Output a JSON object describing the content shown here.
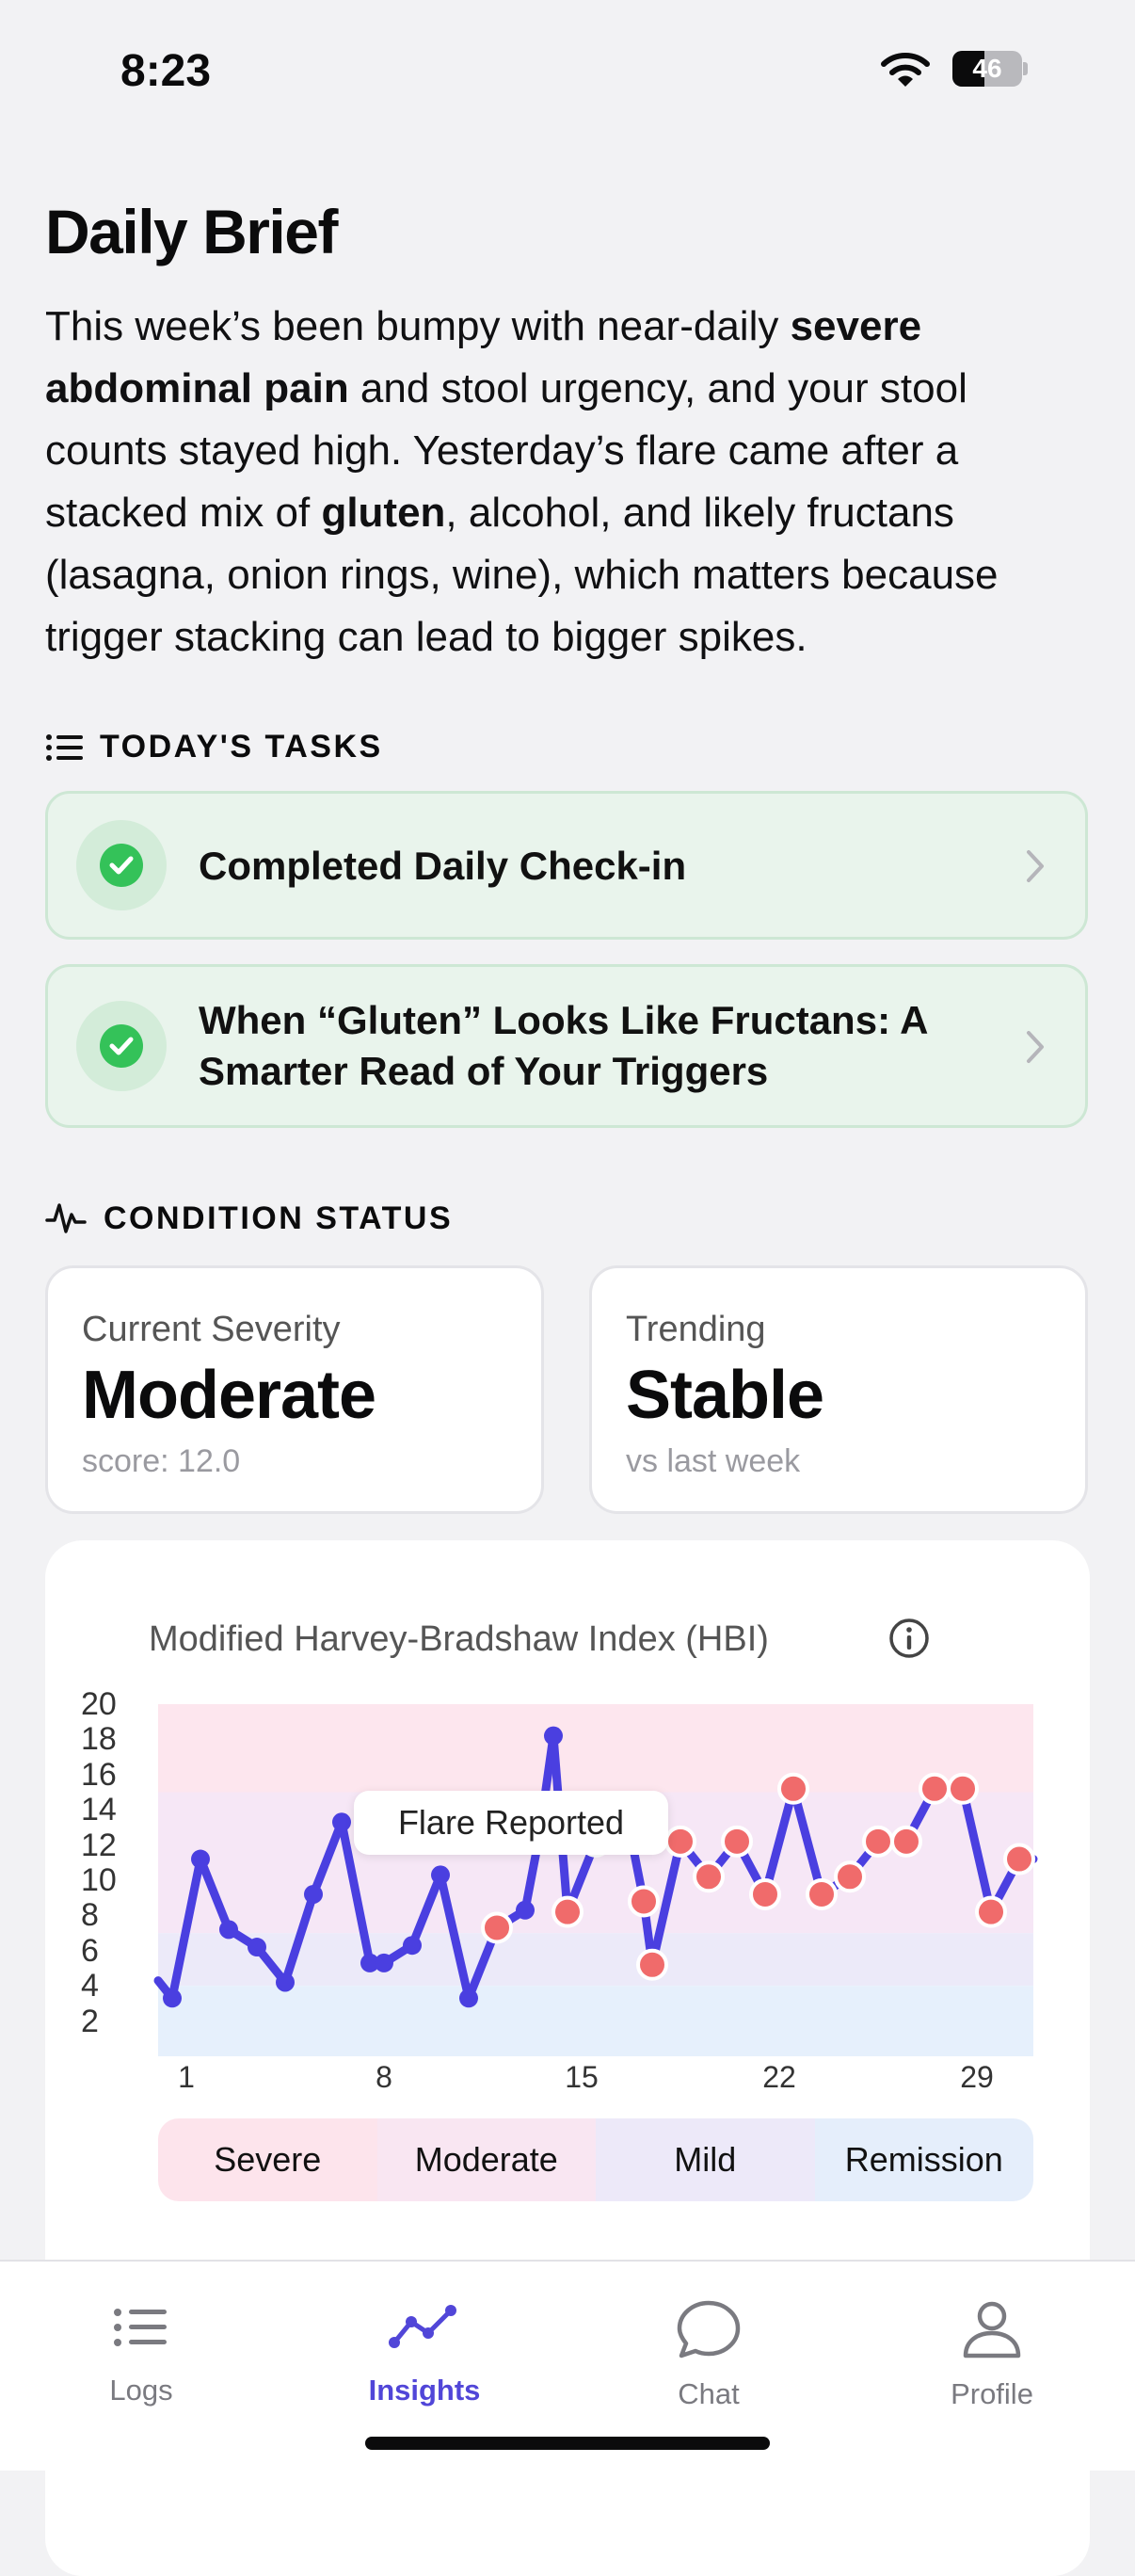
{
  "status_bar": {
    "time": "8:23",
    "battery": "46",
    "battery_level": 0.46
  },
  "brief": {
    "title": "Daily Brief",
    "segments": [
      {
        "t": "This week’s been bumpy with near-daily ",
        "b": false
      },
      {
        "t": "severe abdominal pain",
        "b": true
      },
      {
        "t": " and stool urgency, and your stool counts stayed high. Yesterday’s flare came after a stacked mix of ",
        "b": false
      },
      {
        "t": "gluten",
        "b": true
      },
      {
        "t": ", alcohol, and likely fructans (lasagna, onion rings, wine), which matters because trigger stacking can lead to bigger spikes.",
        "b": false
      }
    ]
  },
  "tasks": {
    "heading": "TODAY'S TASKS",
    "items": [
      {
        "label": "Completed Daily Check-in"
      },
      {
        "label": "When “Gluten” Looks Like Fructans: A Smarter Read of Your Triggers"
      }
    ]
  },
  "condition": {
    "heading": "CONDITION STATUS",
    "severity": {
      "label": "Current Severity",
      "value": "Moderate",
      "sub": "score: 12.0"
    },
    "trend": {
      "label": "Trending",
      "value": "Stable",
      "sub": "vs last week"
    }
  },
  "chart_data": {
    "type": "line",
    "title": "Modified Harvey-Bradshaw Index (HBI)",
    "annotation": "Flare Reported",
    "ylim": [
      0,
      20
    ],
    "y_ticks": [
      2,
      4,
      6,
      8,
      10,
      12,
      14,
      16,
      18,
      20
    ],
    "x_ticks": [
      1,
      8,
      15,
      22,
      29
    ],
    "xlim": [
      0,
      31
    ],
    "bands": [
      {
        "name": "Severe",
        "from": 15,
        "to": 20,
        "color": "#fde6ee"
      },
      {
        "name": "Moderate",
        "from": 7,
        "to": 15,
        "color": "#f6e7f6"
      },
      {
        "name": "Mild",
        "from": 4,
        "to": 7,
        "color": "#eceaf9"
      },
      {
        "name": "Remission",
        "from": 0,
        "to": 4,
        "color": "#e6f0fc"
      }
    ],
    "line_color": "#4a3fe0",
    "flare_color": "#f06b6b",
    "x": [
      0,
      0.5,
      1.5,
      2.5,
      3.5,
      4.5,
      5.5,
      6.5,
      7.5,
      8,
      9,
      10,
      11,
      12,
      13,
      13.5,
      14,
      14.5,
      15.5,
      16.5,
      17.2,
      17.5,
      18.5,
      19.5,
      20.5,
      21.5,
      22.5,
      23.5,
      24.5,
      25.5,
      26.5,
      27.5,
      28.5,
      29.5,
      30.5,
      31
    ],
    "y": [
      4.3,
      3.3,
      11.2,
      7.2,
      6.2,
      4.2,
      9.2,
      13.3,
      5.3,
      5.3,
      6.3,
      10.3,
      3.3,
      7.3,
      8.3,
      12.5,
      18.2,
      8.2,
      12.2,
      14.5,
      8.8,
      5.2,
      12.2,
      10.2,
      12.2,
      9.2,
      15.2,
      9.2,
      10.2,
      12.2,
      12.2,
      15.2,
      15.2,
      8.2,
      11.2,
      11.2
    ],
    "flare_points": [
      13,
      15,
      17,
      18,
      20,
      21,
      22,
      23,
      24,
      25,
      26,
      27,
      28,
      29,
      30,
      31,
      32,
      33,
      34
    ],
    "hidden_segments": [
      [
        15,
        17
      ],
      [
        18,
        19
      ]
    ],
    "legend": [
      "Severe",
      "Moderate",
      "Mild",
      "Remission"
    ]
  },
  "tabbar": {
    "items": [
      {
        "label": "Logs",
        "active": false
      },
      {
        "label": "Insights",
        "active": true
      },
      {
        "label": "Chat",
        "active": false
      },
      {
        "label": "Profile",
        "active": false
      }
    ]
  }
}
